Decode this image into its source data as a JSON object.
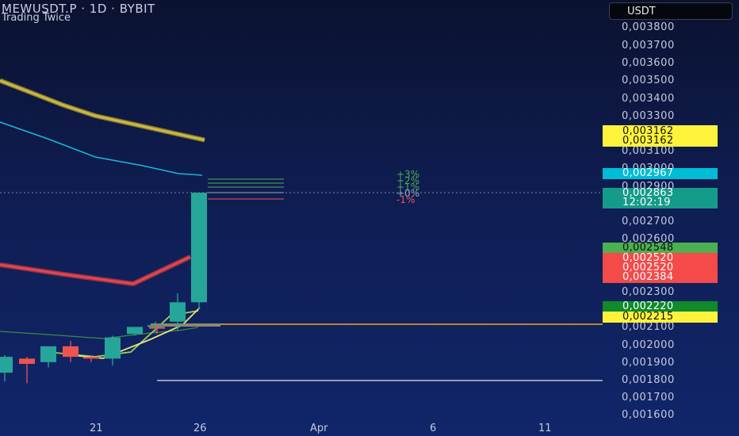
{
  "header": {
    "symbol_line": "MEWUSDT.P · 1D · BYBIT",
    "indicator_name": "Trading Twice"
  },
  "currency_button": "USDT",
  "y_axis_labels": [
    "0,003800",
    "0,003700",
    "0,003600",
    "0,003500",
    "0,003400",
    "0,003300",
    "0,003100",
    "0,003000",
    "0,002900",
    "0,002700",
    "0,002600",
    "0,002300",
    "0,002100",
    "0,002000",
    "0,001900",
    "0,001800",
    "0,001700",
    "0,001600"
  ],
  "price_tags": {
    "ma_yellow_1": "0,003162",
    "ma_yellow_2": "0,003162",
    "ma_cyan": "0,002967",
    "last_price": "0,002863",
    "countdown": "12:02:19",
    "green_level": "0,002548",
    "red_level_1": "0,002520",
    "red_level_2": "0,002520",
    "red_level_3": "0,002384",
    "darkgreen_level": "0,002220",
    "orange_level": "0,002215"
  },
  "percent_labels": [
    "+3%",
    "+2%",
    "+1%",
    "+0%",
    "-1%"
  ],
  "x_axis_labels": [
    "21",
    "26",
    "Apr",
    "6",
    "11"
  ],
  "colors": {
    "bg_top": "#0b1230",
    "bg_bottom": "#10266a",
    "candle_up": "#26a69a",
    "candle_down": "#ef5350",
    "ma_yellow": "#c9b94a",
    "ma_cyan": "#1bb6d6",
    "ma_red": "#e04a5a",
    "orange_line": "#f5a623",
    "tag_yellow": "#fff23b",
    "tag_cyan": "#00bcd4",
    "tag_teal": "#159b8a",
    "tag_green": "#4caf50",
    "tag_red": "#f44a4a",
    "tag_darkgreen": "#0f8a2c"
  },
  "chart_data": {
    "type": "candlestick",
    "candles": [
      {
        "o": 0.00184,
        "h": 0.00194,
        "l": 0.00179,
        "c": 0.00193
      },
      {
        "o": 0.00192,
        "h": 0.00193,
        "l": 0.00178,
        "c": 0.00189
      },
      {
        "o": 0.0019,
        "h": 0.00199,
        "l": 0.00187,
        "c": 0.00199
      },
      {
        "o": 0.00199,
        "h": 0.00202,
        "l": 0.0019,
        "c": 0.00193
      },
      {
        "o": 0.00193,
        "h": 0.00194,
        "l": 0.0019,
        "c": 0.00192
      },
      {
        "o": 0.00192,
        "h": 0.00205,
        "l": 0.00188,
        "c": 0.00204
      },
      {
        "o": 0.00206,
        "h": 0.0021,
        "l": 0.00205,
        "c": 0.0021
      },
      {
        "o": 0.0021,
        "h": 0.00213,
        "l": 0.00207,
        "c": 0.00211
      },
      {
        "o": 0.0021,
        "h": 0.00212,
        "l": 0.00206,
        "c": 0.00209
      },
      {
        "o": 0.00213,
        "h": 0.00229,
        "l": 0.00208,
        "c": 0.00224
      },
      {
        "o": 0.00224,
        "h": 0.00246,
        "l": 0.0022,
        "c": 0.002863
      }
    ],
    "ma_yellow": [
      0.0035,
      0.00343,
      0.00336,
      0.0033,
      0.00325,
      0.003205,
      0.003162
    ],
    "ma_cyan": [
      0.00325,
      0.00321,
      0.00314,
      0.00308,
      0.00303,
      0.00299,
      0.002967
    ],
    "ylim": [
      0.0016,
      0.0038
    ]
  }
}
